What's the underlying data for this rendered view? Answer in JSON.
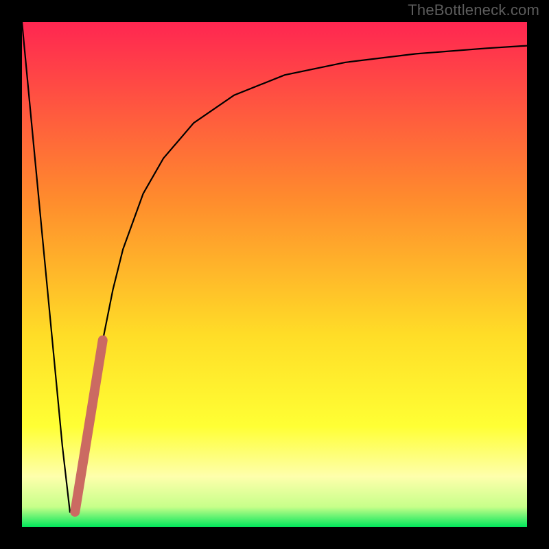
{
  "attribution": "TheBottleneck.com",
  "colors": {
    "frame": "#000000",
    "attribution_text": "#5d5d5d",
    "curve": "#000000",
    "thick_segment": "#cb6a62",
    "gradient_top": "#ff2651",
    "gradient_mid1": "#ff8b2d",
    "gradient_mid2": "#ffdd27",
    "gradient_yellow": "#ffff34",
    "gradient_pale": "#feffac",
    "gradient_green": "#00e65b"
  },
  "chart_data": {
    "type": "line",
    "title": "",
    "xlabel": "",
    "ylabel": "",
    "xlim": [
      0,
      100
    ],
    "ylim": [
      0,
      100
    ],
    "series": [
      {
        "name": "bottleneck-curve",
        "x": [
          0,
          2,
          4,
          6,
          8,
          9.5,
          10.5,
          12,
          14,
          16,
          18,
          20,
          24,
          28,
          34,
          42,
          52,
          64,
          78,
          92,
          100
        ],
        "values": [
          100,
          79,
          58,
          37,
          16,
          3,
          3,
          11,
          24,
          37,
          47,
          55,
          66,
          73,
          80,
          85.5,
          89.5,
          92,
          93.7,
          94.8,
          95.3
        ]
      }
    ],
    "highlight_segment": {
      "name": "thick-overlay",
      "x_start": 10.5,
      "y_start": 3,
      "x_end": 16,
      "y_end": 37
    }
  }
}
